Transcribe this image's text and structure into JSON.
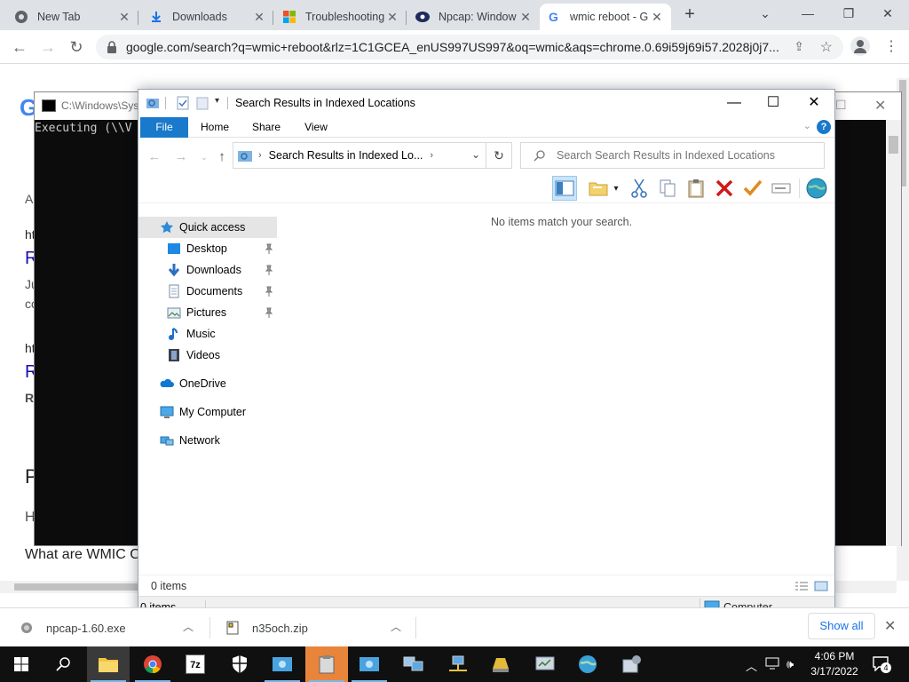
{
  "chrome": {
    "tabs": [
      {
        "title": "New Tab",
        "icon": "chrome-icon"
      },
      {
        "title": "Downloads",
        "icon": "download-icon"
      },
      {
        "title": "Troubleshooting",
        "icon": "microsoft-icon"
      },
      {
        "title": "Npcap: Window",
        "icon": "nmap-eye-icon"
      },
      {
        "title": "wmic reboot - G",
        "icon": "google-icon"
      }
    ],
    "url": "google.com/search?q=wmic+reboot&rlz=1C1GCEA_enUS997US997&oq=wmic&aqs=chrome.0.69i59j69i57.2028j0j7..."
  },
  "google_page": {
    "fragments": [
      "A",
      "ht",
      "R",
      "Ju",
      "co",
      "ht",
      "R",
      "R",
      "P",
      "H",
      "What are WMIC C"
    ]
  },
  "cmd": {
    "title": "C:\\Windows\\Sys",
    "text": "Executing (\\\\V"
  },
  "explorer": {
    "title": "Search Results in Indexed Locations",
    "ribbon_tabs": [
      "File",
      "Home",
      "Share",
      "View"
    ],
    "breadcrumb": "Search Results in Indexed Lo...",
    "search_placeholder": "Search Search Results in Indexed Locations",
    "empty_message": "No items match your search.",
    "nav": {
      "quick_access": "Quick access",
      "items": [
        "Desktop",
        "Downloads",
        "Documents",
        "Pictures",
        "Music",
        "Videos"
      ],
      "onedrive": "OneDrive",
      "my_computer": "My Computer",
      "network": "Network"
    },
    "status_count": "0 items",
    "status_count_bottom": "0 items",
    "status_zone": "Computer"
  },
  "downloads": {
    "items": [
      {
        "name": "npcap-1.60.exe"
      },
      {
        "name": "n35och.zip"
      }
    ],
    "show_all": "Show all"
  },
  "taskbar": {
    "time": "4:06 PM",
    "date": "3/17/2022",
    "notifications": "4"
  },
  "colors": {
    "file_tab": "#1979ca",
    "taskbar": "#101010",
    "link": "#1a0dab"
  }
}
